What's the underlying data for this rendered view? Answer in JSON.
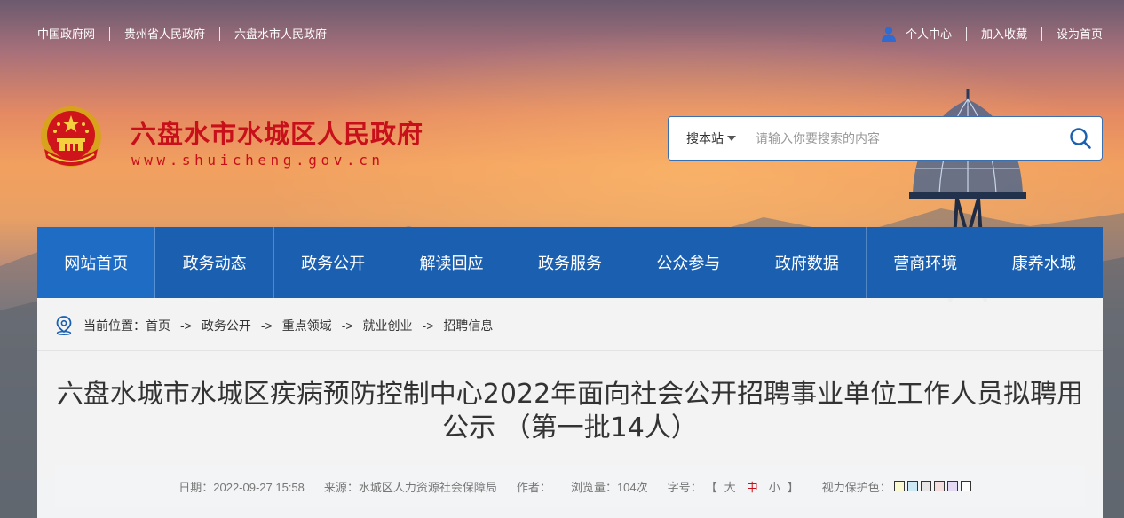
{
  "topbar": {
    "links": [
      "中国政府网",
      "贵州省人民政府",
      "六盘水市人民政府"
    ],
    "user_center": "个人中心",
    "add_favorite": "加入收藏",
    "set_homepage": "设为首页"
  },
  "header": {
    "site_title": "六盘水市水城区人民政府",
    "site_url": "www.shuicheng.gov.cn"
  },
  "search": {
    "scope_label": "搜本站",
    "placeholder": "请输入你要搜索的内容"
  },
  "nav": {
    "items": [
      "网站首页",
      "政务动态",
      "政务公开",
      "解读回应",
      "政务服务",
      "公众参与",
      "政府数据",
      "营商环境",
      "康养水城"
    ],
    "active_index": 0
  },
  "breadcrumb": {
    "label": "当前位置：",
    "items": [
      "首页",
      "政务公开",
      "重点领域",
      "就业创业",
      "招聘信息"
    ],
    "separator": "->"
  },
  "article": {
    "title_line1": "六盘水城市水城区疾病预防控制中心2022年面向社会公开招聘事业单位工作人员拟聘用",
    "title_line2": "公示 （第一批14人）"
  },
  "meta": {
    "date": "日期：2022-09-27 15:58",
    "source": "来源：水城区人力资源社会保障局",
    "author": "作者：",
    "views": "浏览量：104次",
    "font_size_label": "字号：",
    "font_open": "【",
    "font_large": "大",
    "font_medium": "中",
    "font_small": "小",
    "font_close": "】",
    "eye_protect_label": "视力保护色：",
    "swatch_colors": [
      "#fafad2",
      "#cce8f4",
      "#e6e6e6",
      "#f5dede",
      "#e4d9f2",
      "#ffffff"
    ]
  },
  "colors": {
    "brand_red": "#c8101a",
    "nav_blue": "#1a5fb0"
  }
}
